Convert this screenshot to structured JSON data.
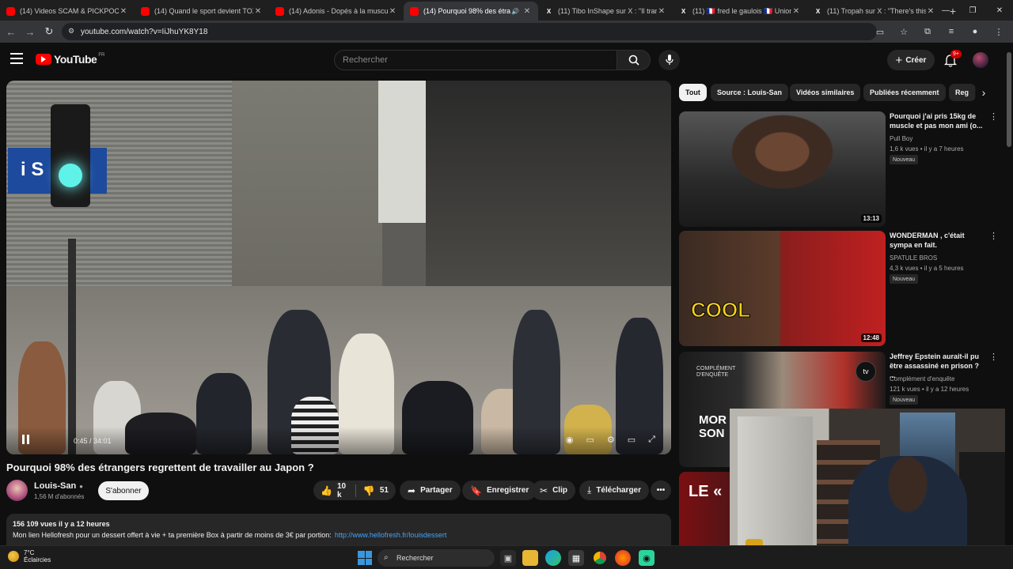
{
  "browser": {
    "tabs": [
      {
        "title": "(14) Videos SCAM & PICKPOCKET",
        "icon": "youtube-icon",
        "active": false
      },
      {
        "title": "(14) Quand le sport devient TOXIQUE",
        "icon": "youtube-icon",
        "active": false
      },
      {
        "title": "(14) Adonis - Dopés à la muscu",
        "icon": "youtube-icon",
        "active": false
      },
      {
        "title": "(14) Pourquoi 98% des étra",
        "icon": "youtube-icon",
        "active": true
      },
      {
        "title": "(11) Tibo InShape sur X : \"Il trans",
        "icon": "x-icon",
        "active": false
      },
      {
        "title": "(11) 🇫🇷 fred le gaulois 🇫🇷 Union",
        "icon": "x-icon",
        "active": false
      },
      {
        "title": "(11) Tropah sur X : \"There's this",
        "icon": "x-icon",
        "active": false
      }
    ],
    "url": "youtube.com/watch?v=IiJhuYK8Y18"
  },
  "youtube": {
    "logo_text": "YouTube",
    "logo_country": "FR",
    "search_placeholder": "Rechercher",
    "create_label": "Créer",
    "notif_count": "9+"
  },
  "video": {
    "title": "Pourquoi 98% des étrangers regrettent de travailler au Japon ?",
    "time": "0:45 / 34:01",
    "progress": 0.022,
    "channel": "Louis-San",
    "subscribers": "1,56 M d'abonnés",
    "subscribe_label": "S'abonner",
    "likes": "10 k",
    "dislikes": "51",
    "share_label": "Partager",
    "save_label": "Enregistrer",
    "clip_label": "Clip",
    "download_label": "Télécharger",
    "views_date": "156 109 vues  il y a 12 heures",
    "desc_text": "Mon lien Hellofresh pour un dessert offert à vie + ta première Box à partir de moins de 3€ par portion:",
    "desc_link": "http://www.hellofresh.fr/louisdessert"
  },
  "chips": [
    "Tout",
    "Source : Louis-San",
    "Vidéos similaires",
    "Publiées récemment",
    "Reg"
  ],
  "recommendations": [
    {
      "title": "Pourquoi j'ai pris 15kg de muscle et pas mon ami (o...",
      "channel": "Pull Boy",
      "meta": "1,6 k vues • il y a 7 heures",
      "badge": "Nouveau",
      "duration": "13:13"
    },
    {
      "title": "WONDERMAN , c'était sympa en fait.",
      "channel": "SPATULE BROS",
      "meta": "4,3 k vues • il y a 5 heures",
      "badge": "Nouveau",
      "duration": "12:48",
      "thumb_text": "COOL"
    },
    {
      "title": "Jeffrey Epstein aurait-il pu être assassiné en prison ? ...",
      "channel": "Complément d'enquête",
      "meta": "121 k vues • il y a 12 heures",
      "badge": "Nouveau",
      "duration": "",
      "thumb_text": "MOR SON",
      "thumb_caption": "COMPLÉMENT D'ENQUÊTE",
      "thumb_logo": "tv"
    },
    {
      "title": "",
      "channel": "",
      "meta": "",
      "badge": "",
      "duration": "",
      "thumb_text": "LE «"
    }
  ],
  "taskbar": {
    "temp": "7°C",
    "weather": "Éclaircies",
    "search_label": "Rechercher"
  },
  "colors": {
    "accent_red": "#ff0000",
    "link_blue": "#3ea6ff",
    "background": "#0f0f0f"
  }
}
